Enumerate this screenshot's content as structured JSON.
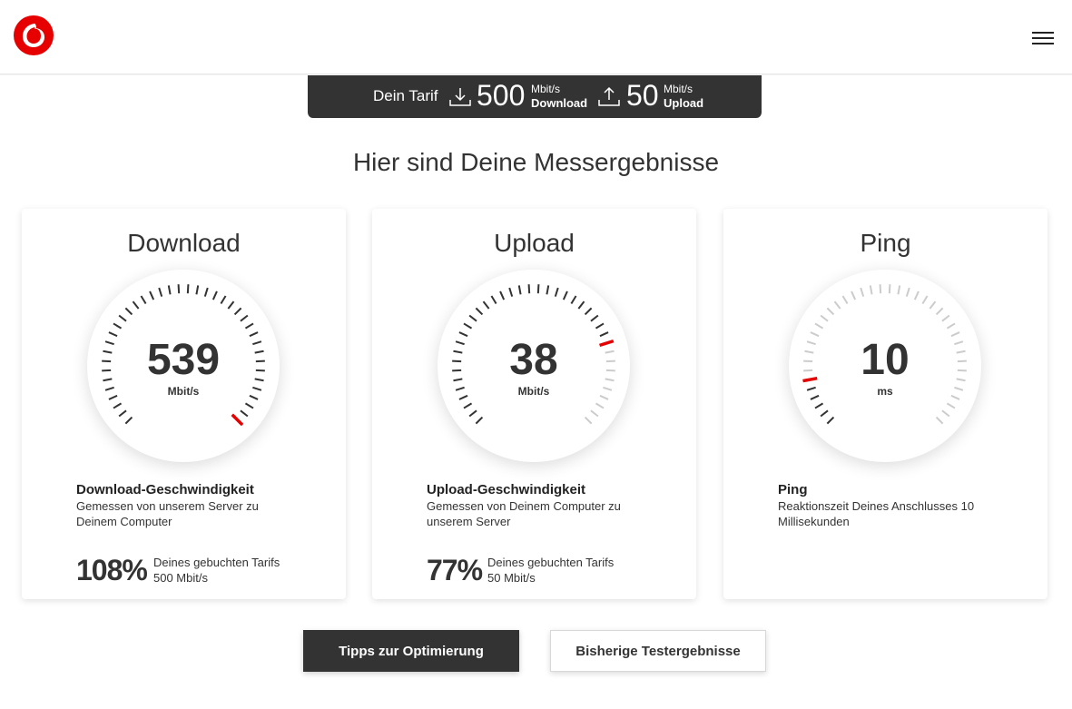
{
  "brand": {
    "name": "Vodafone",
    "accent": "#e60000",
    "dark": "#333333"
  },
  "header": {
    "menu_icon": "hamburger-icon"
  },
  "tarif": {
    "label": "Dein Tarif",
    "download": {
      "value": "500",
      "unit": "Mbit/s",
      "name": "Download",
      "icon": "download-icon"
    },
    "upload": {
      "value": "50",
      "unit": "Mbit/s",
      "name": "Upload",
      "icon": "upload-icon"
    }
  },
  "heading": "Hier sind Deine Messergebnisse",
  "cards": [
    {
      "id": "download",
      "title": "Download",
      "value": "539",
      "unit": "Mbit/s",
      "level": 1.0,
      "desc_title": "Download-Geschwindigkeit",
      "desc_text": "Gemessen von unserem Server zu Deinem Computer",
      "pct": "108%",
      "pct_label_1": "Deines gebuchten Tarifs",
      "pct_label_2": "500 Mbit/s"
    },
    {
      "id": "upload",
      "title": "Upload",
      "value": "38",
      "unit": "Mbit/s",
      "level": 0.77,
      "desc_title": "Upload-Geschwindigkeit",
      "desc_text": "Gemessen von Deinem Computer zu unserem Server",
      "pct": "77%",
      "pct_label_1": "Deines gebuchten Tarifs",
      "pct_label_2": "50 Mbit/s"
    },
    {
      "id": "ping",
      "title": "Ping",
      "value": "10",
      "unit": "ms",
      "level": 0.13,
      "desc_title": "Ping",
      "desc_text": "Reaktionszeit Deines Anschlusses 10 Millisekunden"
    }
  ],
  "buttons": {
    "primary": "Tipps zur Optimierung",
    "secondary": "Bisherige Testergebnisse"
  }
}
